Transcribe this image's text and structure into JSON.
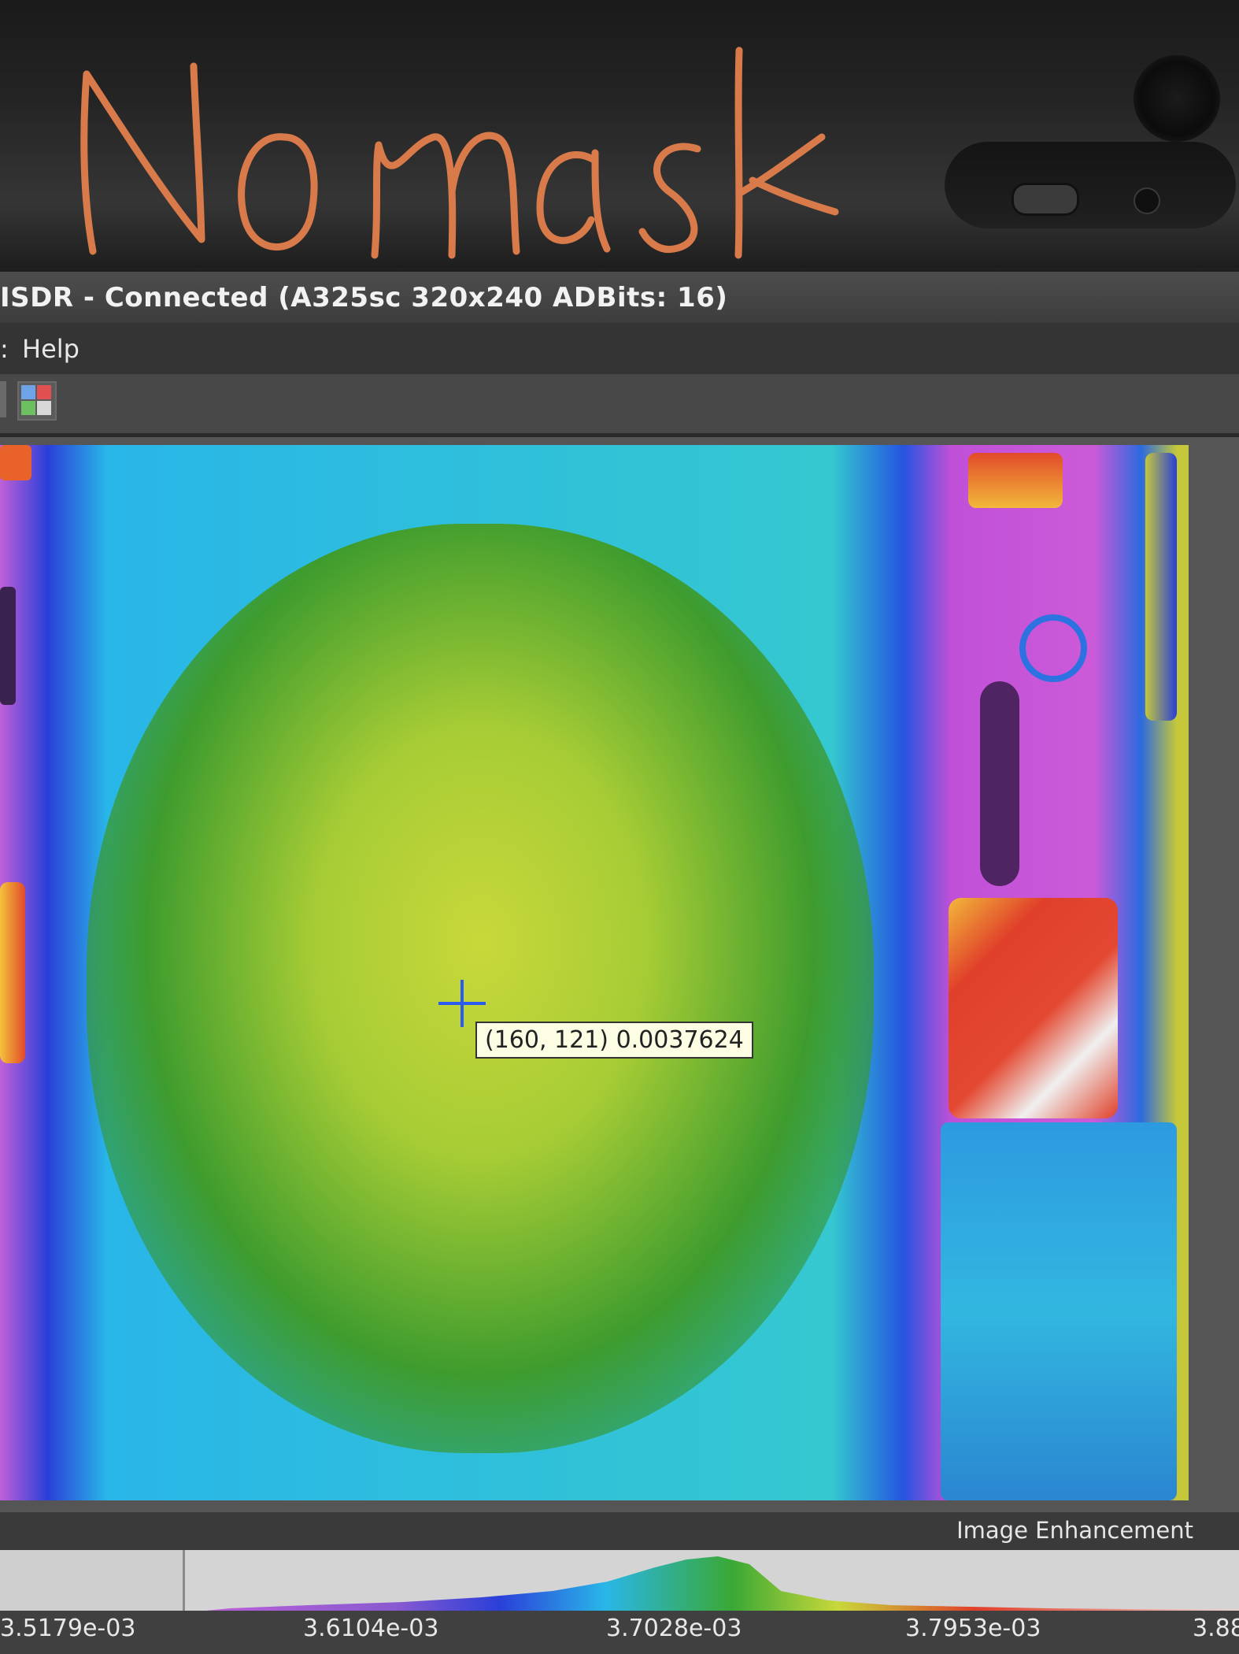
{
  "annotation": {
    "text": "No mask",
    "color": "#d97a4a"
  },
  "window": {
    "title": "ISDR - Connected (A325sc 320x240 ADBits: 16)"
  },
  "menu": {
    "items": [
      ":",
      "Help"
    ]
  },
  "toolbar": {
    "icons": [
      "toolbar-icon",
      "image-compare-icon"
    ]
  },
  "thermal_view": {
    "cursor": {
      "pixel": "(160, 121)",
      "value": "0.0037624"
    },
    "palette": [
      "#c060d8",
      "#2a3fd8",
      "#29b6e8",
      "#3aa835",
      "#c8d83a",
      "#e0402a",
      "#ffffff"
    ]
  },
  "status": {
    "label": "Image Enhancement"
  },
  "histogram": {
    "ticks": [
      "3.5179e-03",
      "3.6104e-03",
      "3.7028e-03",
      "3.7953e-03",
      "3.88"
    ]
  }
}
